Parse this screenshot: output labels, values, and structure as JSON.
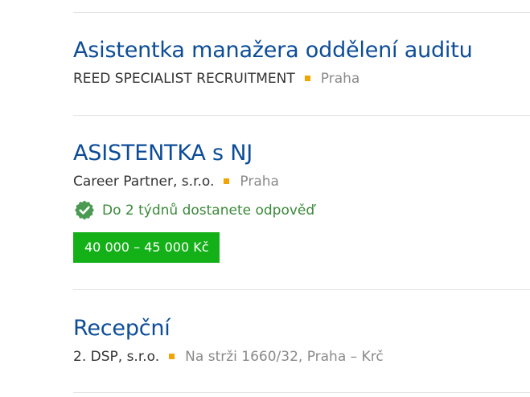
{
  "jobs": [
    {
      "title": "Asistentka manažera oddělení auditu",
      "company": "REED SPECIALIST RECRUITMENT",
      "location": "Praha"
    },
    {
      "title": "ASISTENTKA s NJ",
      "company": "Career Partner, s.r.o.",
      "location": "Praha",
      "response_note": "Do 2 týdnů dostanete odpověď",
      "response_icon": "check-circle-icon",
      "salary": "40 000 – 45 000 Kč"
    },
    {
      "title": "Recepční",
      "company": "2. DSP, s.r.o.",
      "location": "Na strži 1660/32, Praha – Krč"
    }
  ],
  "colors": {
    "title": "#0d4d98",
    "separator": "#f0a500",
    "salary_badge": "#14b017",
    "response_text": "#3a8a3a",
    "check_icon": "#4a9a52"
  }
}
